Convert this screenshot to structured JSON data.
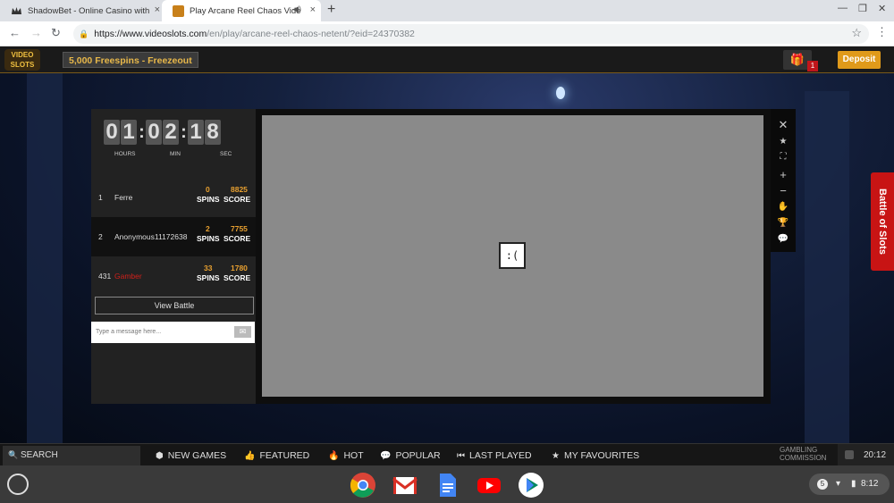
{
  "browser": {
    "tabs": [
      {
        "title": "ShadowBet - Online Casino with",
        "favicon": "crown-icon",
        "active": false
      },
      {
        "title": "Play Arcane Reel Chaos Vide",
        "favicon": "game-icon",
        "active": true
      }
    ],
    "close_glyph": "×",
    "newtab_glyph": "+",
    "url_host": "https://www.videoslots.com",
    "url_path": "/en/play/arcane-reel-chaos-netent/?eid=24370382"
  },
  "site": {
    "logo_text": "VIDEO SLOTS",
    "promo": "5,000 Freespins - Freezeout",
    "gift_count": "1",
    "deposit": "Deposit"
  },
  "battle": {
    "timer": {
      "hours": [
        "0",
        "1"
      ],
      "minutes": [
        "0",
        "2"
      ],
      "seconds": [
        "1",
        "8"
      ],
      "labels": {
        "hours": "HOURS",
        "min": "MIN",
        "sec": "SEC"
      }
    },
    "rows": [
      {
        "rank": "1",
        "name": "Ferre",
        "spins": "0",
        "score": "8825"
      },
      {
        "rank": "2",
        "name": "Anonymous11172638",
        "spins": "2",
        "score": "7755"
      },
      {
        "rank": "431",
        "name": "Gamber",
        "spins": "33",
        "score": "1780"
      }
    ],
    "spins_label": "SPINS",
    "score_label": "SCORE",
    "view_battle": "View Battle",
    "message_placeholder": "Type a message here..."
  },
  "game": {
    "error_face": ":(",
    "side_tab": "Battle of Slots"
  },
  "bottom_nav": {
    "search": "SEARCH",
    "items": [
      {
        "label": "NEW GAMES",
        "icon": "dice-icon"
      },
      {
        "label": "FEATURED",
        "icon": "thumbs-up-icon"
      },
      {
        "label": "HOT",
        "icon": "flame-icon"
      },
      {
        "label": "POPULAR",
        "icon": "chat-heart-icon"
      },
      {
        "label": "LAST PLAYED",
        "icon": "rewind-icon"
      },
      {
        "label": "MY FAVOURITES",
        "icon": "star-icon"
      }
    ],
    "gambling_commission": "GAMBLING COMMISSION",
    "clock": "20:12"
  },
  "shelf": {
    "apps": [
      "chrome-icon",
      "gmail-icon",
      "docs-icon",
      "youtube-icon",
      "play-store-icon"
    ],
    "tray_badge": "5",
    "tray_time": "8:12"
  }
}
